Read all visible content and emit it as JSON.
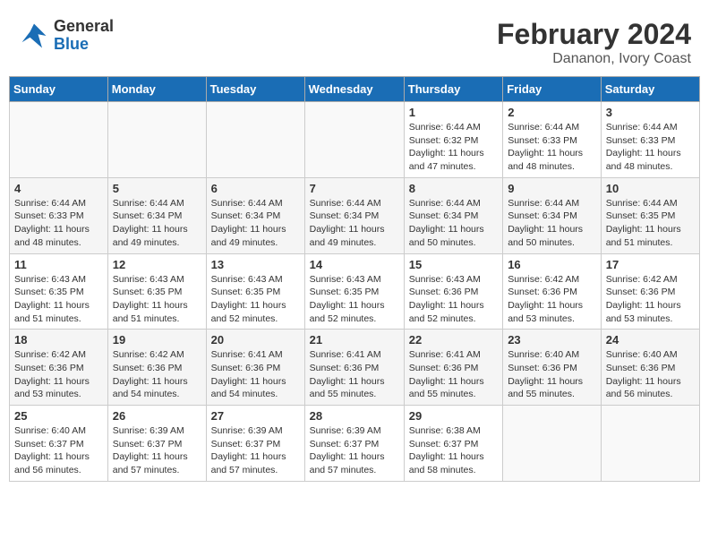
{
  "header": {
    "logo_line1": "General",
    "logo_line2": "Blue",
    "month_year": "February 2024",
    "location": "Dananon, Ivory Coast"
  },
  "days_of_week": [
    "Sunday",
    "Monday",
    "Tuesday",
    "Wednesday",
    "Thursday",
    "Friday",
    "Saturday"
  ],
  "weeks": [
    [
      {
        "day": "",
        "empty": true
      },
      {
        "day": "",
        "empty": true
      },
      {
        "day": "",
        "empty": true
      },
      {
        "day": "",
        "empty": true
      },
      {
        "day": "1",
        "sunrise": "6:44 AM",
        "sunset": "6:32 PM",
        "daylight": "11 hours and 47 minutes."
      },
      {
        "day": "2",
        "sunrise": "6:44 AM",
        "sunset": "6:33 PM",
        "daylight": "11 hours and 48 minutes."
      },
      {
        "day": "3",
        "sunrise": "6:44 AM",
        "sunset": "6:33 PM",
        "daylight": "11 hours and 48 minutes."
      }
    ],
    [
      {
        "day": "4",
        "sunrise": "6:44 AM",
        "sunset": "6:33 PM",
        "daylight": "11 hours and 48 minutes."
      },
      {
        "day": "5",
        "sunrise": "6:44 AM",
        "sunset": "6:34 PM",
        "daylight": "11 hours and 49 minutes."
      },
      {
        "day": "6",
        "sunrise": "6:44 AM",
        "sunset": "6:34 PM",
        "daylight": "11 hours and 49 minutes."
      },
      {
        "day": "7",
        "sunrise": "6:44 AM",
        "sunset": "6:34 PM",
        "daylight": "11 hours and 49 minutes."
      },
      {
        "day": "8",
        "sunrise": "6:44 AM",
        "sunset": "6:34 PM",
        "daylight": "11 hours and 50 minutes."
      },
      {
        "day": "9",
        "sunrise": "6:44 AM",
        "sunset": "6:34 PM",
        "daylight": "11 hours and 50 minutes."
      },
      {
        "day": "10",
        "sunrise": "6:44 AM",
        "sunset": "6:35 PM",
        "daylight": "11 hours and 51 minutes."
      }
    ],
    [
      {
        "day": "11",
        "sunrise": "6:43 AM",
        "sunset": "6:35 PM",
        "daylight": "11 hours and 51 minutes."
      },
      {
        "day": "12",
        "sunrise": "6:43 AM",
        "sunset": "6:35 PM",
        "daylight": "11 hours and 51 minutes."
      },
      {
        "day": "13",
        "sunrise": "6:43 AM",
        "sunset": "6:35 PM",
        "daylight": "11 hours and 52 minutes."
      },
      {
        "day": "14",
        "sunrise": "6:43 AM",
        "sunset": "6:35 PM",
        "daylight": "11 hours and 52 minutes."
      },
      {
        "day": "15",
        "sunrise": "6:43 AM",
        "sunset": "6:36 PM",
        "daylight": "11 hours and 52 minutes."
      },
      {
        "day": "16",
        "sunrise": "6:42 AM",
        "sunset": "6:36 PM",
        "daylight": "11 hours and 53 minutes."
      },
      {
        "day": "17",
        "sunrise": "6:42 AM",
        "sunset": "6:36 PM",
        "daylight": "11 hours and 53 minutes."
      }
    ],
    [
      {
        "day": "18",
        "sunrise": "6:42 AM",
        "sunset": "6:36 PM",
        "daylight": "11 hours and 53 minutes."
      },
      {
        "day": "19",
        "sunrise": "6:42 AM",
        "sunset": "6:36 PM",
        "daylight": "11 hours and 54 minutes."
      },
      {
        "day": "20",
        "sunrise": "6:41 AM",
        "sunset": "6:36 PM",
        "daylight": "11 hours and 54 minutes."
      },
      {
        "day": "21",
        "sunrise": "6:41 AM",
        "sunset": "6:36 PM",
        "daylight": "11 hours and 55 minutes."
      },
      {
        "day": "22",
        "sunrise": "6:41 AM",
        "sunset": "6:36 PM",
        "daylight": "11 hours and 55 minutes."
      },
      {
        "day": "23",
        "sunrise": "6:40 AM",
        "sunset": "6:36 PM",
        "daylight": "11 hours and 55 minutes."
      },
      {
        "day": "24",
        "sunrise": "6:40 AM",
        "sunset": "6:36 PM",
        "daylight": "11 hours and 56 minutes."
      }
    ],
    [
      {
        "day": "25",
        "sunrise": "6:40 AM",
        "sunset": "6:37 PM",
        "daylight": "11 hours and 56 minutes."
      },
      {
        "day": "26",
        "sunrise": "6:39 AM",
        "sunset": "6:37 PM",
        "daylight": "11 hours and 57 minutes."
      },
      {
        "day": "27",
        "sunrise": "6:39 AM",
        "sunset": "6:37 PM",
        "daylight": "11 hours and 57 minutes."
      },
      {
        "day": "28",
        "sunrise": "6:39 AM",
        "sunset": "6:37 PM",
        "daylight": "11 hours and 57 minutes."
      },
      {
        "day": "29",
        "sunrise": "6:38 AM",
        "sunset": "6:37 PM",
        "daylight": "11 hours and 58 minutes."
      },
      {
        "day": "",
        "empty": true
      },
      {
        "day": "",
        "empty": true
      }
    ]
  ],
  "labels": {
    "sunrise": "Sunrise:",
    "sunset": "Sunset:",
    "daylight": "Daylight:"
  }
}
